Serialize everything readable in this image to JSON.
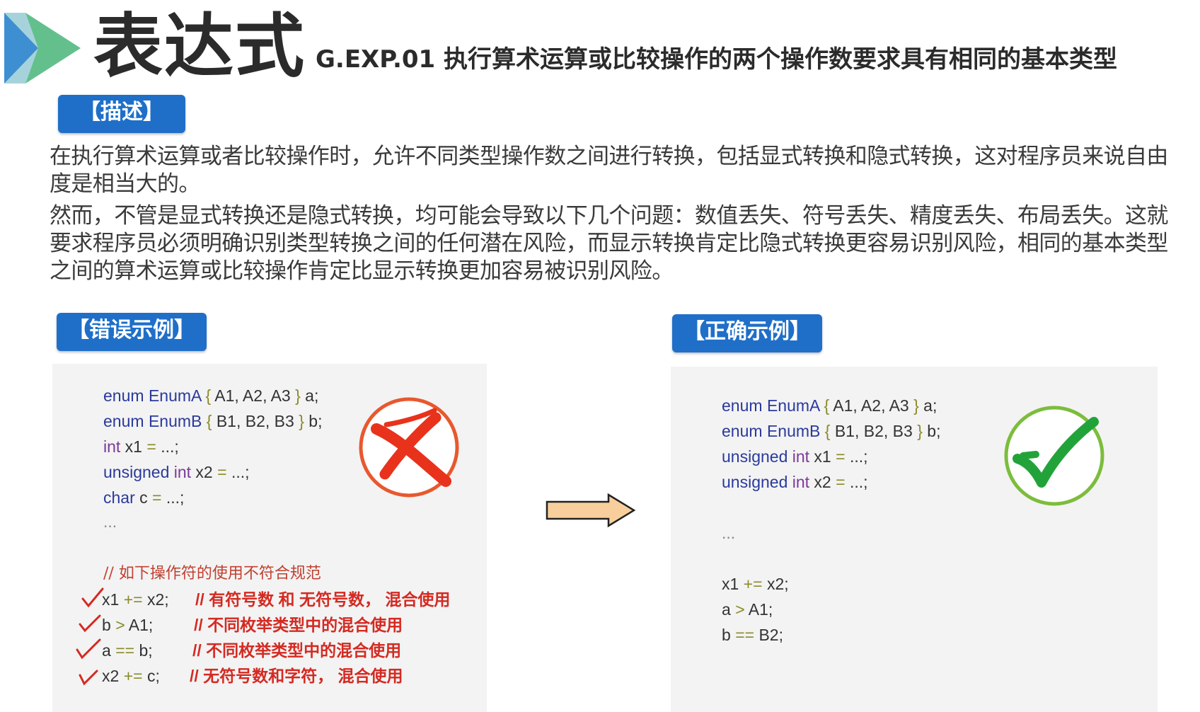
{
  "header": {
    "title": "表达式",
    "subtitle": "G.EXP.01 执行算术运算或比较操作的两个操作数要求具有相同的基本类型"
  },
  "description": {
    "tag": "【描述】",
    "paragraph_1": "在执行算术运算或者比较操作时，允许不同类型操作数之间进行转换，包括显式转换和隐式转换，这对程序员来说自由度是相当大的。",
    "paragraph_2": "然而，不管是显式转换还是隐式转换，均可能会导致以下几个问题：数值丢失、符号丢失、精度丢失、布局丢失。这就要求程序员必须明确识别类型转换之间的任何潜在风险，而显示转换肯定比隐式转换更容易识别风险，相同的基本类型之间的算术运算或比较操作肯定比显示转换更加容易被识别风险。"
  },
  "wrong_example": {
    "tag": "【错误示例】",
    "line1": {
      "kw": "enum",
      "ty": "EnumA",
      "b1": "{",
      "body": " A1, A2, A3 ",
      "b2": "}",
      "tail": " a;"
    },
    "line2": {
      "kw": "enum",
      "ty": "EnumB",
      "b1": "{",
      "body": " B1, B2, B3 ",
      "b2": "}",
      "tail": " b;"
    },
    "line3": {
      "kw": "int",
      "rest": " x1 ",
      "op": "=",
      "tail": " ...;"
    },
    "line4": {
      "kw1": "unsigned",
      "kw2": "int",
      "rest": " x2 ",
      "op": "=",
      "tail": " ...;"
    },
    "line5": {
      "kw": "char",
      "rest": " c ",
      "op": "=",
      "tail": " ...;"
    },
    "ellipsis": "...",
    "comment": "// 如下操作符的使用不符合规范",
    "cases": [
      {
        "code_a": "x1 ",
        "op": "+=",
        "code_b": " x2;",
        "note": "// 有符号数 和 无符号数， 混合使用"
      },
      {
        "code_a": "b ",
        "op": ">",
        "code_b": " A1;",
        "note": "// 不同枚举类型中的混合使用"
      },
      {
        "code_a": "a ",
        "op": "==",
        "code_b": " b;",
        "note": "// 不同枚举类型中的混合使用"
      },
      {
        "code_a": "x2 ",
        "op": "+=",
        "code_b": " c;",
        "note": "// 无符号数和字符， 混合使用"
      }
    ]
  },
  "right_example": {
    "tag": "【正确示例】",
    "line1": {
      "kw": "enum",
      "ty": "EnumA",
      "b1": "{",
      "body": " A1, A2, A3 ",
      "b2": "}",
      "tail": " a;"
    },
    "line2": {
      "kw": "enum",
      "ty": "EnumB",
      "b1": "{",
      "body": " B1, B2, B3 ",
      "b2": "}",
      "tail": " b;"
    },
    "line3": {
      "kw1": "unsigned",
      "kw2": "int",
      "rest": " x1 ",
      "op": "=",
      "tail": " ...;"
    },
    "line4": {
      "kw1": "unsigned",
      "kw2": "int",
      "rest": " x2 ",
      "op": "=",
      "tail": " ...;"
    },
    "ellipsis": "...",
    "cases": [
      {
        "code_a": "x1 ",
        "op": "+=",
        "code_b": " x2;"
      },
      {
        "code_a": "a ",
        "op": ">",
        "code_b": " A1;"
      },
      {
        "code_a": "b ",
        "op": "==",
        "code_b": " B2;"
      }
    ]
  },
  "colors": {
    "tag_bg": "#1f6fc9",
    "keyword": "#2a3a9c",
    "type": "#7a3a9a",
    "operator": "#8a8a2a",
    "error_comment": "#d42a22",
    "cross": "#e8321c",
    "cross_ring": "#e8582e",
    "check": "#22a33a",
    "check_ring": "#7cbd3c",
    "arrow_fill": "#f8cf9c"
  }
}
